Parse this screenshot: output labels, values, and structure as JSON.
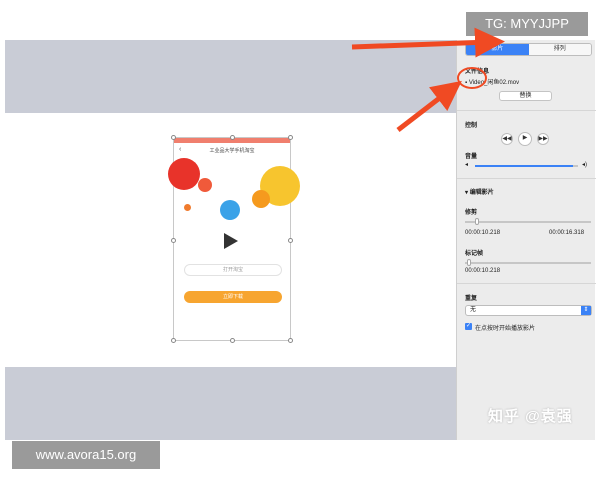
{
  "phone_screen": {
    "nav_title": "工业品大学手机淘宝",
    "back_glyph": "‹",
    "input_placeholder": "打开淘宝",
    "button_label": "立即下载"
  },
  "inspector": {
    "tabs": [
      {
        "label": "影片",
        "active": true
      },
      {
        "label": "排列",
        "active": false
      }
    ],
    "file_info_label": "文件信息",
    "file_name": "Video_闲鱼02.mov",
    "replace_label": "替换",
    "control_label": "控制",
    "controls": [
      "rewind-icon",
      "play-icon",
      "forward-icon"
    ],
    "volume_label": "音量",
    "volume_level": 0.95,
    "edit_movie_label": "编辑影片",
    "trim_label": "修剪",
    "trim_start": "00:00:10.218",
    "trim_end": "00:00:16.318",
    "poster_label": "标记帧",
    "poster_time": "00:00:10.218",
    "repeat_label": "重复",
    "repeat_value": "无",
    "autoplay_label": "在点按时开始播放影片",
    "autoplay_checked": true
  },
  "overlays": {
    "tg_tag": "TG: MYYJJPP",
    "site_tag": "www.avora15.org",
    "zhihu_watermark": "知乎 @袁强"
  },
  "colors": {
    "accent": "#3b82f6",
    "arrow": "#f04a23",
    "canvas_bg": "#c9ccd6",
    "phone_button": "#f7a530"
  }
}
